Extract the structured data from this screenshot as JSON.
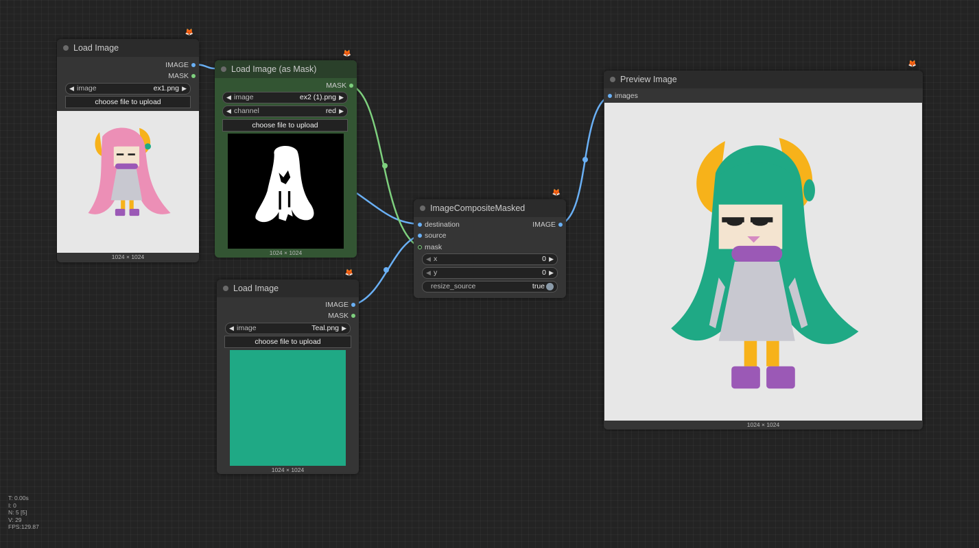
{
  "nodes": {
    "load1": {
      "title": "Load Image",
      "outputs": [
        "IMAGE",
        "MASK"
      ],
      "image_widget": {
        "name": "image",
        "value": "ex1.png"
      },
      "upload_label": "choose file to upload",
      "dims": "1024 × 1024"
    },
    "mask": {
      "title": "Load Image (as Mask)",
      "outputs": [
        "MASK"
      ],
      "image_widget": {
        "name": "image",
        "value": "ex2 (1).png"
      },
      "channel_widget": {
        "name": "channel",
        "value": "red"
      },
      "upload_label": "choose file to upload",
      "dims": "1024 × 1024"
    },
    "load2": {
      "title": "Load Image",
      "outputs": [
        "IMAGE",
        "MASK"
      ],
      "image_widget": {
        "name": "image",
        "value": "Teal.png"
      },
      "upload_label": "choose file to upload",
      "dims": "1024 × 1024",
      "color": "#1fa985"
    },
    "composite": {
      "title": "ImageCompositeMasked",
      "inputs": [
        "destination",
        "source",
        "mask"
      ],
      "outputs": [
        "IMAGE"
      ],
      "x_widget": {
        "name": "x",
        "value": "0"
      },
      "y_widget": {
        "name": "y",
        "value": "0"
      },
      "resize_widget": {
        "name": "resize_source",
        "value": "true"
      }
    },
    "preview": {
      "title": "Preview Image",
      "inputs": [
        "images"
      ],
      "dims": "1024 × 1024"
    }
  },
  "stats": [
    "T: 0.00s",
    "I: 0",
    "N: 5 [5]",
    "V: 29",
    "FPS:129.87"
  ],
  "colors": {
    "image_link": "#6ab0f5",
    "mask_link": "#7ed07e",
    "pink_hair": "#ec8fb6",
    "teal_hair": "#1fa985",
    "horn": "#f7b21a",
    "scarf": "#9b59b6",
    "dress": "#c8c8d0"
  },
  "icons": {
    "node_badge": "fox-icon",
    "arrow_left": "◀",
    "arrow_right": "▶"
  }
}
